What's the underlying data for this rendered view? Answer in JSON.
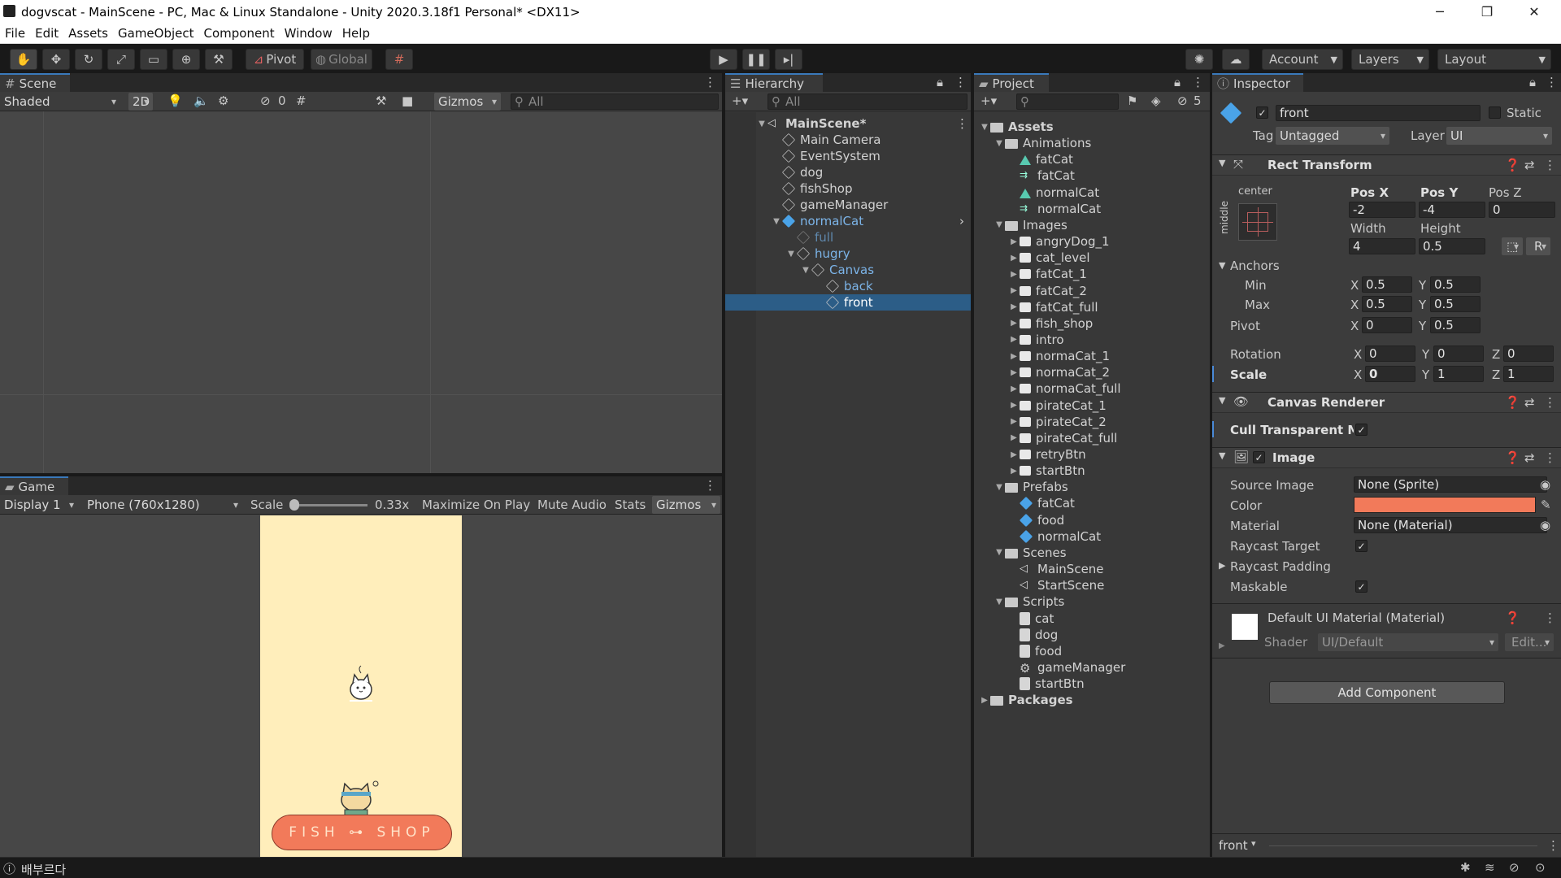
{
  "window": {
    "title": "dogvscat - MainScene - PC, Mac & Linux Standalone - Unity 2020.3.18f1 Personal* <DX11>"
  },
  "menu": [
    "File",
    "Edit",
    "Assets",
    "GameObject",
    "Component",
    "Window",
    "Help"
  ],
  "toolbar": {
    "pivot": "Pivot",
    "global": "Global",
    "account": "Account",
    "layers": "Layers",
    "layout": "Layout"
  },
  "scene": {
    "tab": "Scene",
    "shading": "Shaded",
    "mode2d": "2D",
    "hidden_count": "0",
    "gizmos": "Gizmos",
    "search_placeholder": "All"
  },
  "game": {
    "tab": "Game",
    "display": "Display 1",
    "resolution": "Phone (760x1280)",
    "scale_label": "Scale",
    "scale_value": "0.33x",
    "maximize": "Maximize On Play",
    "mute": "Mute Audio",
    "stats": "Stats",
    "gizmos": "Gizmos",
    "shop_text": "FISH ⊶ SHOP",
    "colors": {
      "bg": "#ffeebb",
      "sign": "#f27a5a"
    }
  },
  "hierarchy": {
    "tab": "Hierarchy",
    "search_placeholder": "All",
    "items": [
      {
        "label": "MainScene*",
        "type": "scene",
        "expanded": true
      },
      {
        "label": "Main Camera",
        "type": "go"
      },
      {
        "label": "EventSystem",
        "type": "go"
      },
      {
        "label": "dog",
        "type": "go"
      },
      {
        "label": "fishShop",
        "type": "go"
      },
      {
        "label": "gameManager",
        "type": "go"
      },
      {
        "label": "normalCat",
        "type": "prefab",
        "expanded": true
      },
      {
        "label": "full",
        "type": "go-disabled"
      },
      {
        "label": "hugry",
        "type": "go",
        "expanded": true
      },
      {
        "label": "Canvas",
        "type": "go",
        "expanded": true
      },
      {
        "label": "back",
        "type": "go"
      },
      {
        "label": "front",
        "type": "go",
        "selected": true
      }
    ]
  },
  "project": {
    "tab": "Project",
    "hidden_count": "5",
    "items": [
      {
        "label": "Assets",
        "kind": "folder"
      },
      {
        "label": "Animations",
        "kind": "folder"
      },
      {
        "label": "fatCat",
        "kind": "anim"
      },
      {
        "label": "fatCat",
        "kind": "controller"
      },
      {
        "label": "normalCat",
        "kind": "anim"
      },
      {
        "label": "normalCat",
        "kind": "controller"
      },
      {
        "label": "Images",
        "kind": "folder"
      },
      {
        "label": "angryDog_1",
        "kind": "img"
      },
      {
        "label": "cat_level",
        "kind": "img"
      },
      {
        "label": "fatCat_1",
        "kind": "img"
      },
      {
        "label": "fatCat_2",
        "kind": "img"
      },
      {
        "label": "fatCat_full",
        "kind": "img"
      },
      {
        "label": "fish_shop",
        "kind": "img"
      },
      {
        "label": "intro",
        "kind": "img"
      },
      {
        "label": "normaCat_1",
        "kind": "img"
      },
      {
        "label": "normaCat_2",
        "kind": "img"
      },
      {
        "label": "normaCat_full",
        "kind": "img"
      },
      {
        "label": "pirateCat_1",
        "kind": "img"
      },
      {
        "label": "pirateCat_2",
        "kind": "img"
      },
      {
        "label": "pirateCat_full",
        "kind": "img"
      },
      {
        "label": "retryBtn",
        "kind": "img"
      },
      {
        "label": "startBtn",
        "kind": "img"
      },
      {
        "label": "Prefabs",
        "kind": "folder"
      },
      {
        "label": "fatCat",
        "kind": "prefab"
      },
      {
        "label": "food",
        "kind": "prefab"
      },
      {
        "label": "normalCat",
        "kind": "prefab"
      },
      {
        "label": "Scenes",
        "kind": "folder"
      },
      {
        "label": "MainScene",
        "kind": "scene"
      },
      {
        "label": "StartScene",
        "kind": "scene"
      },
      {
        "label": "Scripts",
        "kind": "folder"
      },
      {
        "label": "cat",
        "kind": "script"
      },
      {
        "label": "dog",
        "kind": "script"
      },
      {
        "label": "food",
        "kind": "script"
      },
      {
        "label": "gameManager",
        "kind": "gear"
      },
      {
        "label": "startBtn",
        "kind": "script"
      },
      {
        "label": "Packages",
        "kind": "folder"
      }
    ]
  },
  "inspector": {
    "tab": "Inspector",
    "name": "front",
    "static": "Static",
    "tag_label": "Tag",
    "tag": "Untagged",
    "layer_label": "Layer",
    "layer": "UI",
    "rect": {
      "title": "Rect Transform",
      "anchor_h": "center",
      "anchor_v": "middle",
      "posx_label": "Pos X",
      "posy_label": "Pos Y",
      "posz_label": "Pos Z",
      "posx": "-2",
      "posy": "-4",
      "posz": "0",
      "width_label": "Width",
      "height_label": "Height",
      "width": "4",
      "height": "0.5",
      "r_btn": "R",
      "anchors_label": "Anchors",
      "min_label": "Min",
      "max_label": "Max",
      "min_x": "0.5",
      "min_y": "0.5",
      "max_x": "0.5",
      "max_y": "0.5",
      "pivot_label": "Pivot",
      "pivot_x": "0",
      "pivot_y": "0.5",
      "rotation_label": "Rotation",
      "rot_x": "0",
      "rot_y": "0",
      "rot_z": "0",
      "scale_label": "Scale",
      "scale_x": "0",
      "scale_y": "1",
      "scale_z": "1",
      "x": "X",
      "y": "Y",
      "z": "Z"
    },
    "canvas_renderer": {
      "title": "Canvas Renderer",
      "cull_label": "Cull Transparent Me"
    },
    "image": {
      "title": "Image",
      "source_label": "Source Image",
      "source": "None (Sprite)",
      "color_label": "Color",
      "color": "#f27a5a",
      "material_label": "Material",
      "material": "None (Material)",
      "raycast_label": "Raycast Target",
      "padding_label": "Raycast Padding",
      "maskable_label": "Maskable"
    },
    "material": {
      "title": "Default UI Material (Material)",
      "shader_label": "Shader",
      "shader": "UI/Default",
      "edit": "Edit..."
    },
    "add_component": "Add Component",
    "footer_name": "front"
  },
  "status": {
    "text": "배부르다"
  }
}
